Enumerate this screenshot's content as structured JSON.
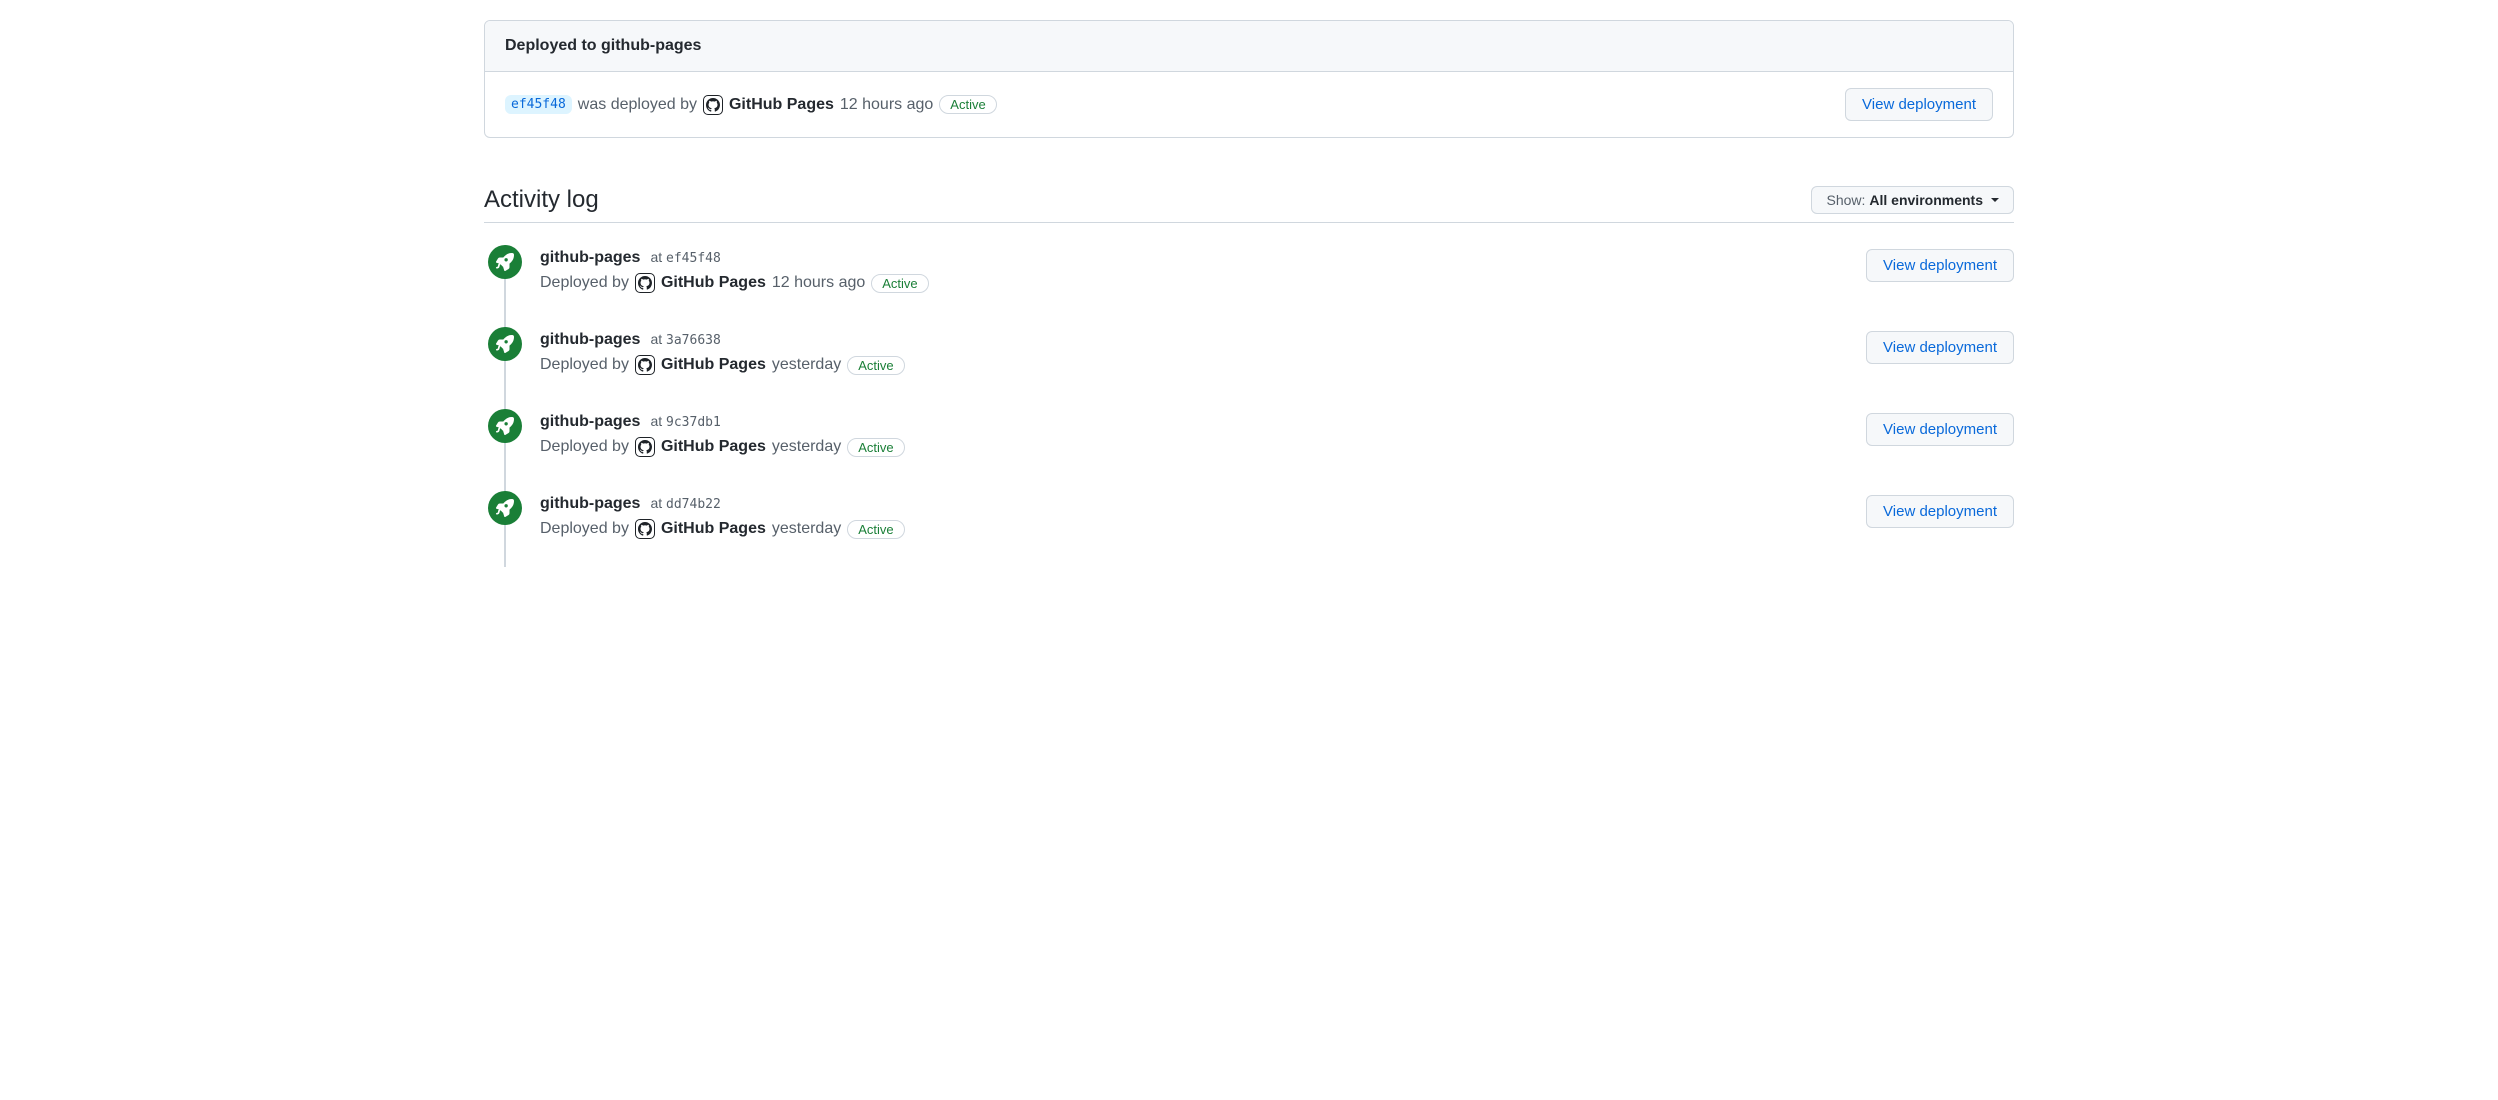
{
  "colors": {
    "accent": "#0969da",
    "success": "#1a7f37",
    "muted": "#57606a"
  },
  "card": {
    "header": "Deployed to github-pages",
    "commit": "ef45f48",
    "was_deployed_by": "was deployed by",
    "author": "GitHub Pages",
    "time": "12 hours ago",
    "status": "Active",
    "view_button": "View deployment"
  },
  "section": {
    "title": "Activity log",
    "filter_label": "Show:",
    "filter_value": "All environments"
  },
  "labels": {
    "at": "at",
    "deployed_by": "Deployed by",
    "view_deployment": "View deployment"
  },
  "timeline": [
    {
      "env": "github-pages",
      "commit": "ef45f48",
      "author": "GitHub Pages",
      "time": "12 hours ago",
      "status": "Active"
    },
    {
      "env": "github-pages",
      "commit": "3a76638",
      "author": "GitHub Pages",
      "time": "yesterday",
      "status": "Active"
    },
    {
      "env": "github-pages",
      "commit": "9c37db1",
      "author": "GitHub Pages",
      "time": "yesterday",
      "status": "Active"
    },
    {
      "env": "github-pages",
      "commit": "dd74b22",
      "author": "GitHub Pages",
      "time": "yesterday",
      "status": "Active"
    }
  ]
}
